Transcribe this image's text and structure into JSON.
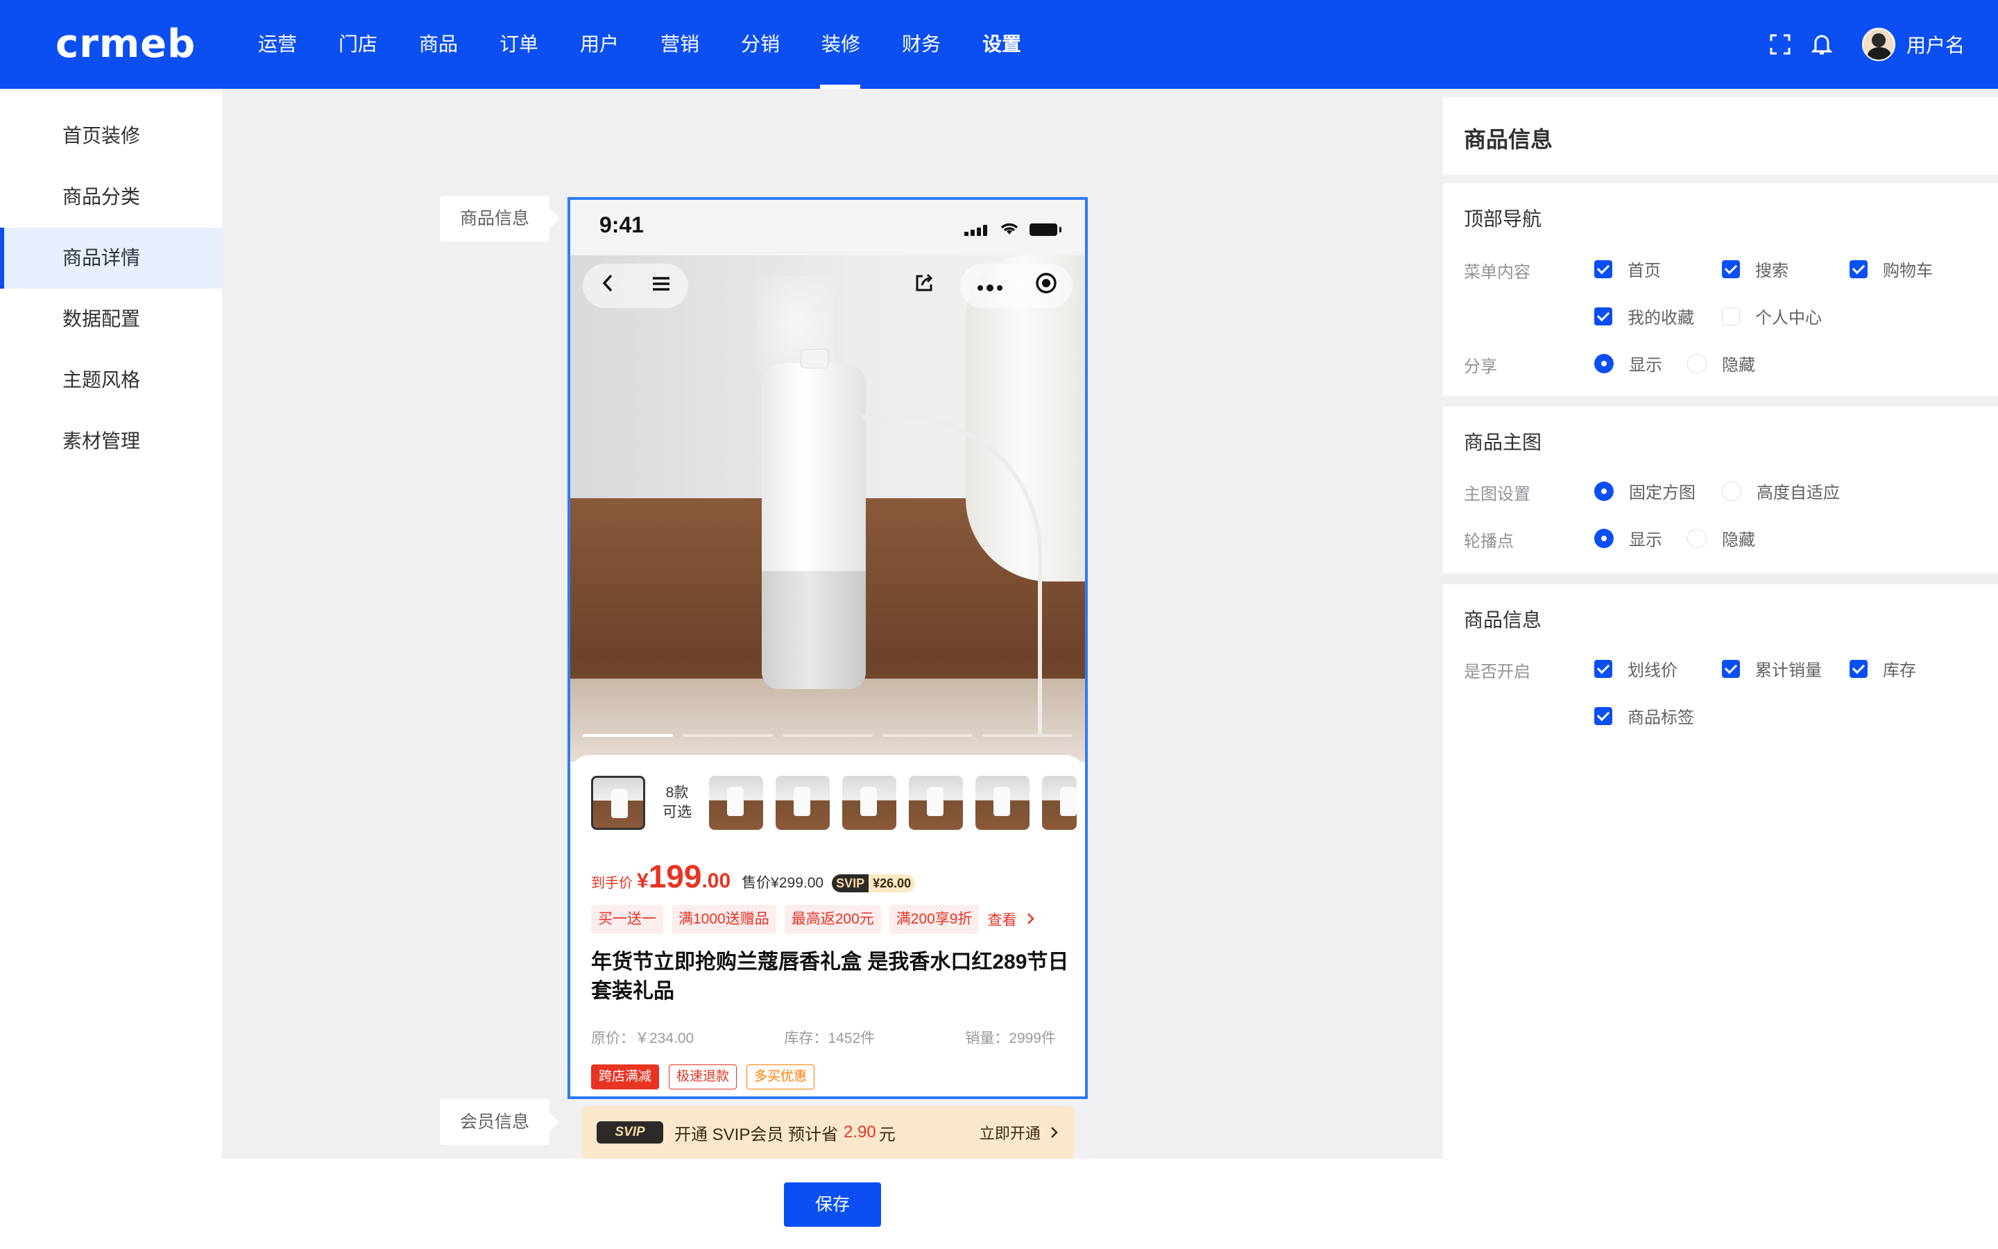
{
  "brand": {
    "logo_text": "crmeb"
  },
  "nav": {
    "items": [
      {
        "label": "运营"
      },
      {
        "label": "门店"
      },
      {
        "label": "商品"
      },
      {
        "label": "订单"
      },
      {
        "label": "用户"
      },
      {
        "label": "营销"
      },
      {
        "label": "分销"
      },
      {
        "label": "装修"
      },
      {
        "label": "财务"
      },
      {
        "label": "设置"
      }
    ],
    "active": "装修",
    "username": "用户名"
  },
  "sidebar": {
    "items": [
      {
        "label": "首页装修"
      },
      {
        "label": "商品分类"
      },
      {
        "label": "商品详情"
      },
      {
        "label": "数据配置"
      },
      {
        "label": "主题风格"
      },
      {
        "label": "素材管理"
      }
    ],
    "active": "商品详情"
  },
  "canvas": {
    "tag_product": "商品信息",
    "tag_member": "会员信息",
    "phone": {
      "time": "9:41",
      "thumb_count_line1": "8款",
      "thumb_count_line2": "可选",
      "price_label": "到手价",
      "price_yen": "¥",
      "price_int": "199",
      "price_dec": ".00",
      "sale_price": "售价¥299.00",
      "svip_tag": "SVIP",
      "svip_price": "¥26.00",
      "promos": [
        "买一送一",
        "满1000送赠品",
        "最高返200元",
        "满200享9折"
      ],
      "promo_more": "查看",
      "title": "年货节立即抢购兰蔻唇香礼盒 是我香水口红289节日套装礼品",
      "original_price": "原价：￥234.00",
      "stock": "库存：1452件",
      "sales": "销量：2999件",
      "labels": [
        "跨店满减",
        "极速退款",
        "多买优惠"
      ]
    },
    "member": {
      "logo": "SVIP",
      "text": "开通 SVIP会员 预计省",
      "amount": "2.90",
      "unit": "元",
      "open": "立即开通"
    }
  },
  "save_label": "保存",
  "right_panel": {
    "header": "商品信息",
    "top_nav": {
      "title": "顶部导航",
      "menu_label": "菜单内容",
      "menu_options": [
        {
          "label": "首页",
          "checked": true
        },
        {
          "label": "搜索",
          "checked": true
        },
        {
          "label": "购物车",
          "checked": true
        },
        {
          "label": "我的收藏",
          "checked": true
        },
        {
          "label": "个人中心",
          "checked": false
        }
      ],
      "share_label": "分享",
      "share_options": [
        {
          "label": "显示",
          "selected": true
        },
        {
          "label": "隐藏",
          "selected": false
        }
      ]
    },
    "main_image": {
      "title": "商品主图",
      "setting_label": "主图设置",
      "setting_options": [
        {
          "label": "固定方图",
          "selected": true
        },
        {
          "label": "高度自适应",
          "selected": false
        }
      ],
      "dots_label": "轮播点",
      "dots_options": [
        {
          "label": "显示",
          "selected": true
        },
        {
          "label": "隐藏",
          "selected": false
        }
      ]
    },
    "product_info": {
      "title": "商品信息",
      "enable_label": "是否开启",
      "options": [
        {
          "label": "划线价",
          "checked": true
        },
        {
          "label": "累计销量",
          "checked": true
        },
        {
          "label": "库存",
          "checked": true
        },
        {
          "label": "商品标签",
          "checked": true
        }
      ]
    }
  },
  "colors": {
    "primary": "#0b4ff2",
    "price_red": "#e93323",
    "canvas_bg": "#f0f0f2"
  }
}
